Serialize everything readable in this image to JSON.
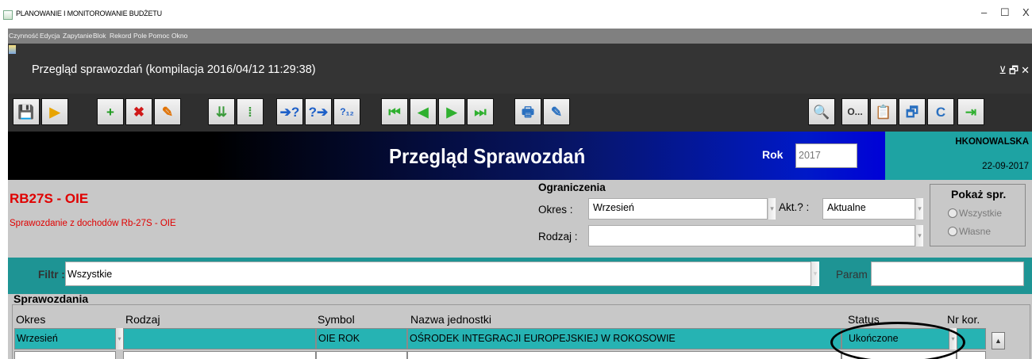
{
  "os": {
    "title": "PLANOWANIE I MONITOROWANIE BUDŻETU",
    "minimize": "–",
    "maximize": "☐",
    "close": "X"
  },
  "menu": [
    "Czynność",
    "Edycja",
    "Zapytanie",
    "Blok",
    "Rekord",
    "Pole",
    "Pomoc",
    "Okno"
  ],
  "window": {
    "title": "Przegląd sprawozdań (kompilacja 2016/04/12 11:29:38)",
    "controls": "⊻🗗✕"
  },
  "toolbar": {
    "buttons": [
      {
        "name": "save",
        "glyph": "💾",
        "color": "#1f63b5"
      },
      {
        "name": "exit-form",
        "glyph": "▶",
        "color": "#e8a400"
      },
      {
        "name": "insert-record",
        "glyph": "+",
        "color": "#1e9a1e"
      },
      {
        "name": "delete-record",
        "glyph": "✖",
        "color": "#d01818"
      },
      {
        "name": "clear-record",
        "glyph": "✎",
        "color": "#e07000"
      },
      {
        "name": "duplicate",
        "glyph": "⇊",
        "color": "#3a9a3a"
      },
      {
        "name": "split",
        "glyph": "⁞",
        "color": "#3a9a3a"
      },
      {
        "name": "enter-query",
        "glyph": "➔?",
        "color": "#1e60c8"
      },
      {
        "name": "execute-query",
        "glyph": "?➔",
        "color": "#1e60c8"
      },
      {
        "name": "count-query",
        "glyph": "?₁₂",
        "color": "#1e60c8"
      },
      {
        "name": "first-record",
        "glyph": "⏮",
        "color": "#2fb02f"
      },
      {
        "name": "prev-record",
        "glyph": "◀",
        "color": "#2fb02f"
      },
      {
        "name": "next-record",
        "glyph": "▶",
        "color": "#2fb02f"
      },
      {
        "name": "last-record",
        "glyph": "⏭",
        "color": "#2fb02f"
      },
      {
        "name": "print",
        "glyph": "🖶",
        "color": "#2a70c0"
      },
      {
        "name": "edit",
        "glyph": "✎",
        "color": "#2a70c0"
      }
    ],
    "right_buttons": [
      {
        "name": "preview",
        "glyph": "🔍",
        "color": "#2a70c0"
      },
      {
        "name": "options",
        "glyph": "O...",
        "color": "#333"
      },
      {
        "name": "clipboard",
        "glyph": "📋",
        "color": "#2a70c0"
      },
      {
        "name": "windows",
        "glyph": "🗗",
        "color": "#2a70c0"
      },
      {
        "name": "calculator",
        "glyph": "C",
        "color": "#2a70c0"
      },
      {
        "name": "exit",
        "glyph": "⇥",
        "color": "#2fb02f"
      }
    ]
  },
  "header": {
    "title": "Przegląd Sprawozdań",
    "rok_label": "Rok",
    "rok_value": "2017",
    "user": "HKONOWALSKA",
    "date": "22-09-2017"
  },
  "report": {
    "code": "RB27S - OIE",
    "description": "Sprawozdanie z dochodów Rb-27S - OIE"
  },
  "constraints": {
    "title": "Ograniczenia",
    "okres_label": "Okres :",
    "okres_value": "Wrzesień",
    "akt_label": "Akt.? :",
    "akt_value": "Aktualne",
    "rodzaj_label": "Rodzaj :",
    "rodzaj_value": ""
  },
  "pokaz": {
    "title": "Pokaż spr.",
    "option_all": "Wszystkie",
    "option_own": "Własne"
  },
  "filter": {
    "label": "Filtr :",
    "value": "Wszystkie",
    "param_label": "Param",
    "param_value": ""
  },
  "table": {
    "section_title": "Sprawozdania",
    "headers": {
      "okres": "Okres",
      "rodzaj": "Rodzaj",
      "symbol": "Symbol",
      "nazwa": "Nazwa jednostki",
      "status": "Status",
      "nr_kor": "Nr kor."
    },
    "rows": [
      {
        "okres": "Wrzesień",
        "rodzaj": "",
        "symbol": "OIE ROK",
        "nazwa": "OŚRODEK INTEGRACJI EUROPEJSKIEJ W ROKOSOWIE",
        "status": "Ukończone",
        "nr_kor": ""
      }
    ]
  }
}
